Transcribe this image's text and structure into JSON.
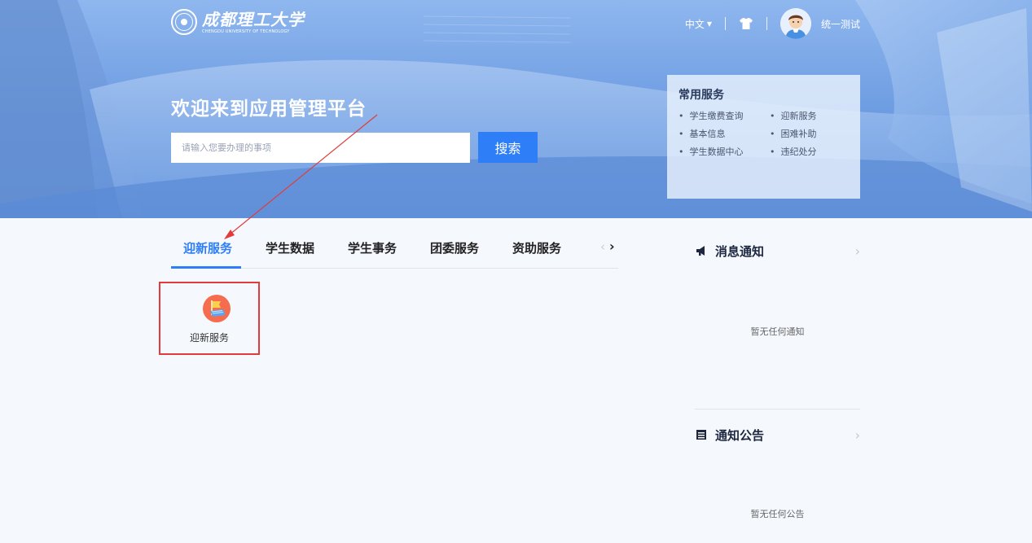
{
  "brand": {
    "name_cn": "成都理工大学",
    "name_en": "CHENGDU UNIVERSITY OF TECHNOLOGY",
    "logo_icon": "university-seal-icon"
  },
  "topnav": {
    "language": "中文",
    "skin_icon": "tshirt-icon",
    "avatar_icon": "avatar-icon",
    "username": "统一测试"
  },
  "hero": {
    "welcome": "欢迎来到应用管理平台",
    "search_placeholder": "请输入您要办理的事项",
    "search_button": "搜索"
  },
  "common_services": {
    "title": "常用服务",
    "items": [
      "学生缴费查询",
      "迎新服务",
      "基本信息",
      "困难补助",
      "学生数据中心",
      "违纪处分"
    ]
  },
  "tabs": {
    "items": [
      "迎新服务",
      "学生数据",
      "学生事务",
      "团委服务",
      "资助服务"
    ],
    "active_index": 0,
    "prev_icon": "chevron-left-icon",
    "next_icon": "chevron-right-icon"
  },
  "apps": [
    {
      "label": "迎新服务",
      "icon": "welcome-flag-icon"
    }
  ],
  "notices": {
    "title": "消息通知",
    "icon": "megaphone-icon",
    "empty_text": "暂无任何通知"
  },
  "announcements": {
    "title": "通知公告",
    "icon": "document-list-icon",
    "empty_text": "暂无任何公告"
  },
  "colors": {
    "accent": "#2d7ef7",
    "highlight_box": "#e23b3b",
    "page_bg": "#f5f8fd",
    "app_icon_bg": "#f56c4e"
  }
}
